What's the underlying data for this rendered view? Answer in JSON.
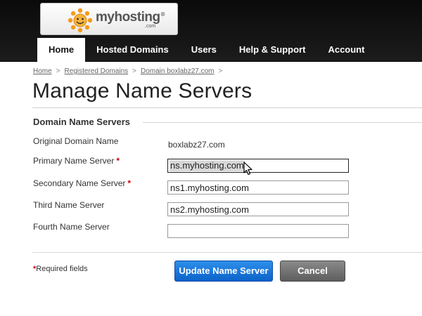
{
  "header": {
    "logo_text": "myhosting",
    "logo_reg": "®",
    "logo_sub": ".com",
    "brand_color": "#f59a1b"
  },
  "nav": {
    "items": [
      {
        "label": "Home",
        "active": true
      },
      {
        "label": "Hosted Domains",
        "active": false
      },
      {
        "label": "Users",
        "active": false
      },
      {
        "label": "Help & Support",
        "active": false
      },
      {
        "label": "Account",
        "active": false
      }
    ]
  },
  "breadcrumb": {
    "items": [
      "Home",
      "Registered Domains",
      "Domain boxlabz27.com"
    ],
    "separator": ">"
  },
  "page": {
    "title": "Manage Name Servers"
  },
  "section": {
    "title": "Domain Name Servers"
  },
  "form": {
    "original_domain": {
      "label": "Original Domain Name",
      "value": "boxlabz27.com"
    },
    "primary": {
      "label": "Primary Name Server",
      "required_mark": "*",
      "value": "ns.myhosting.com"
    },
    "secondary": {
      "label": "Secondary Name Server",
      "required_mark": "*",
      "value": "ns1.myhosting.com"
    },
    "third": {
      "label": "Third Name Server",
      "value": "ns2.myhosting.com"
    },
    "fourth": {
      "label": "Fourth Name Server",
      "value": ""
    }
  },
  "footer": {
    "required_star": "*",
    "required_text": "Required fields",
    "update_label": "Update Name Server",
    "cancel_label": "Cancel"
  },
  "colors": {
    "primary_button": "#1a73e0",
    "cancel_button": "#6e6e6e",
    "required": "#cc0000"
  },
  "icons": [
    "sunflower-logo-icon",
    "mouse-cursor-icon"
  ]
}
